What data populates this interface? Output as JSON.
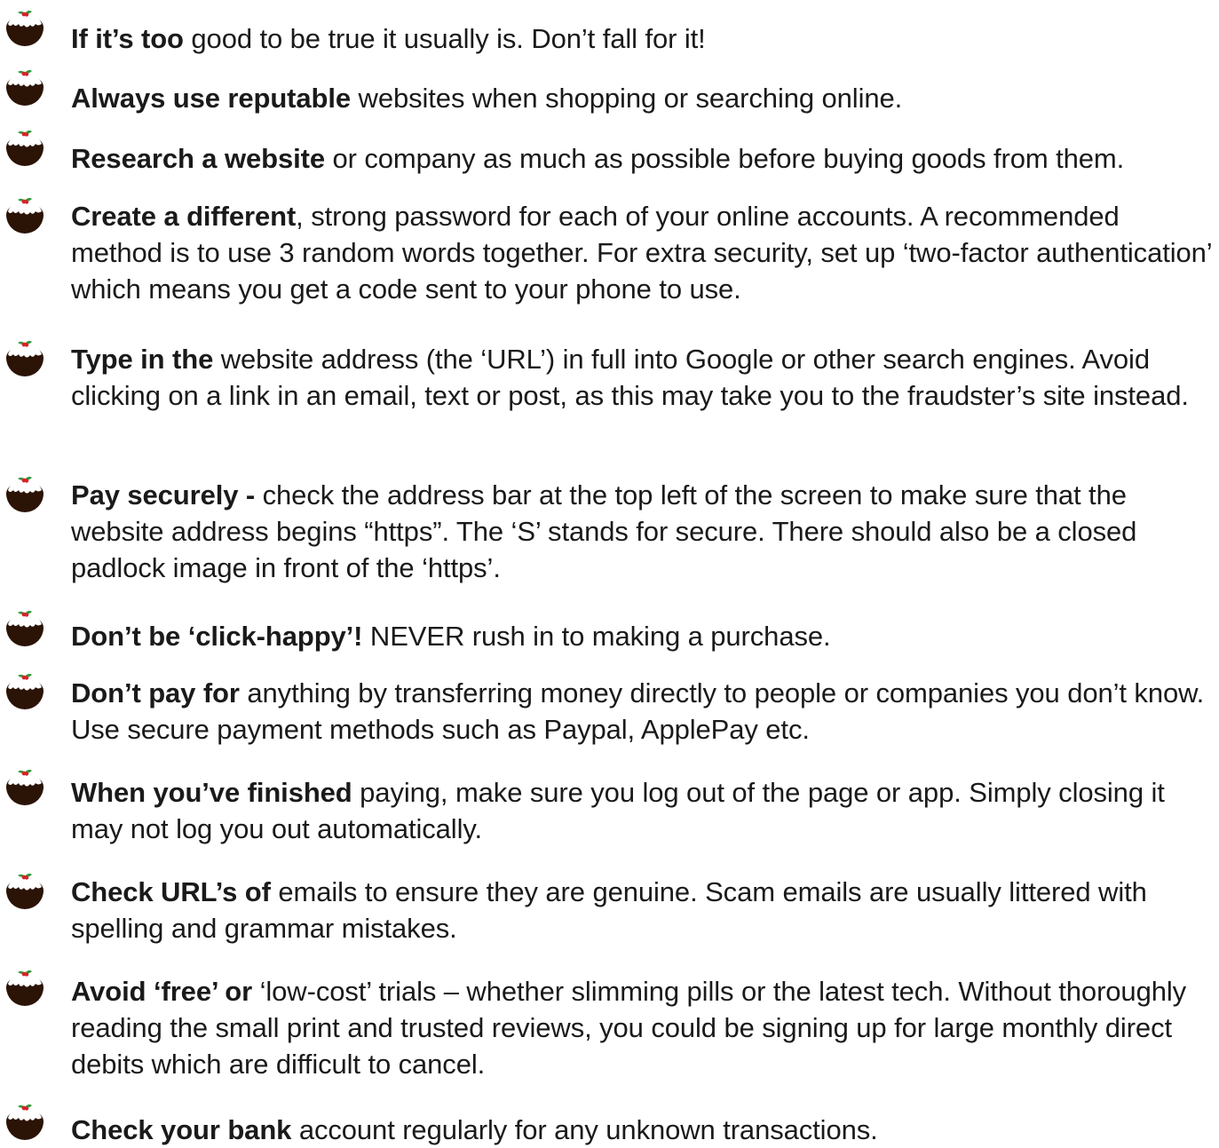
{
  "colors": {
    "text": "#1a1a1a",
    "pudding": "#2b1306",
    "icing": "#ffffff",
    "holly_leaf": "#2f9a3a",
    "holly_berry": "#d6232a"
  },
  "bullet_icon": "christmas-pudding-icon",
  "tips": [
    {
      "lead": "If it’s too",
      "text": " good to be true it usually is. Don’t fall for it!"
    },
    {
      "lead": "Always use reputable",
      "text": " websites when shopping or searching online."
    },
    {
      "lead": "Research a website",
      "text": " or company as much as possible before buying goods from them."
    },
    {
      "lead": "Create a different",
      "text": ", strong password for each of your online accounts. A recommended method is to use 3 random words together. For extra security, set up ‘two-factor authentication’ which means you get a code sent to your phone to use."
    },
    {
      "lead": "Type in the",
      "text": " website address (the ‘URL’) in full into Google or other search engines. Avoid clicking on a link in an email, text or post, as this may take you to the fraudster’s site instead."
    },
    {
      "lead": "Pay securely -",
      "text": " check the address bar at the top left of the screen to make sure that the website address begins “https”.  The ‘S’ stands for secure.  There should also be a closed padlock image in front of the ‘https’."
    },
    {
      "lead": "Don’t be ‘click-happy’!",
      "text": " NEVER rush in to making a purchase."
    },
    {
      "lead": "Don’t pay for",
      "text": " anything by transferring money directly to people or companies you don’t know. Use secure payment methods such as Paypal, ApplePay etc."
    },
    {
      "lead": "When you’ve finished",
      "text": " paying, make sure you log out of the page or app. Simply closing it may not log you out automatically."
    },
    {
      "lead": "Check URL’s of",
      "text": " emails to ensure they are genuine. Scam emails are usually littered with spelling and grammar mistakes."
    },
    {
      "lead": "Avoid ‘free’ or",
      "text": " ‘low-cost’ trials – whether slimming pills or the latest tech. Without thoroughly reading the small print and trusted reviews, you could be signing up for large monthly direct debits which are difficult to cancel."
    },
    {
      "lead": "Check your bank",
      "text": " account regularly for any unknown transactions."
    }
  ]
}
